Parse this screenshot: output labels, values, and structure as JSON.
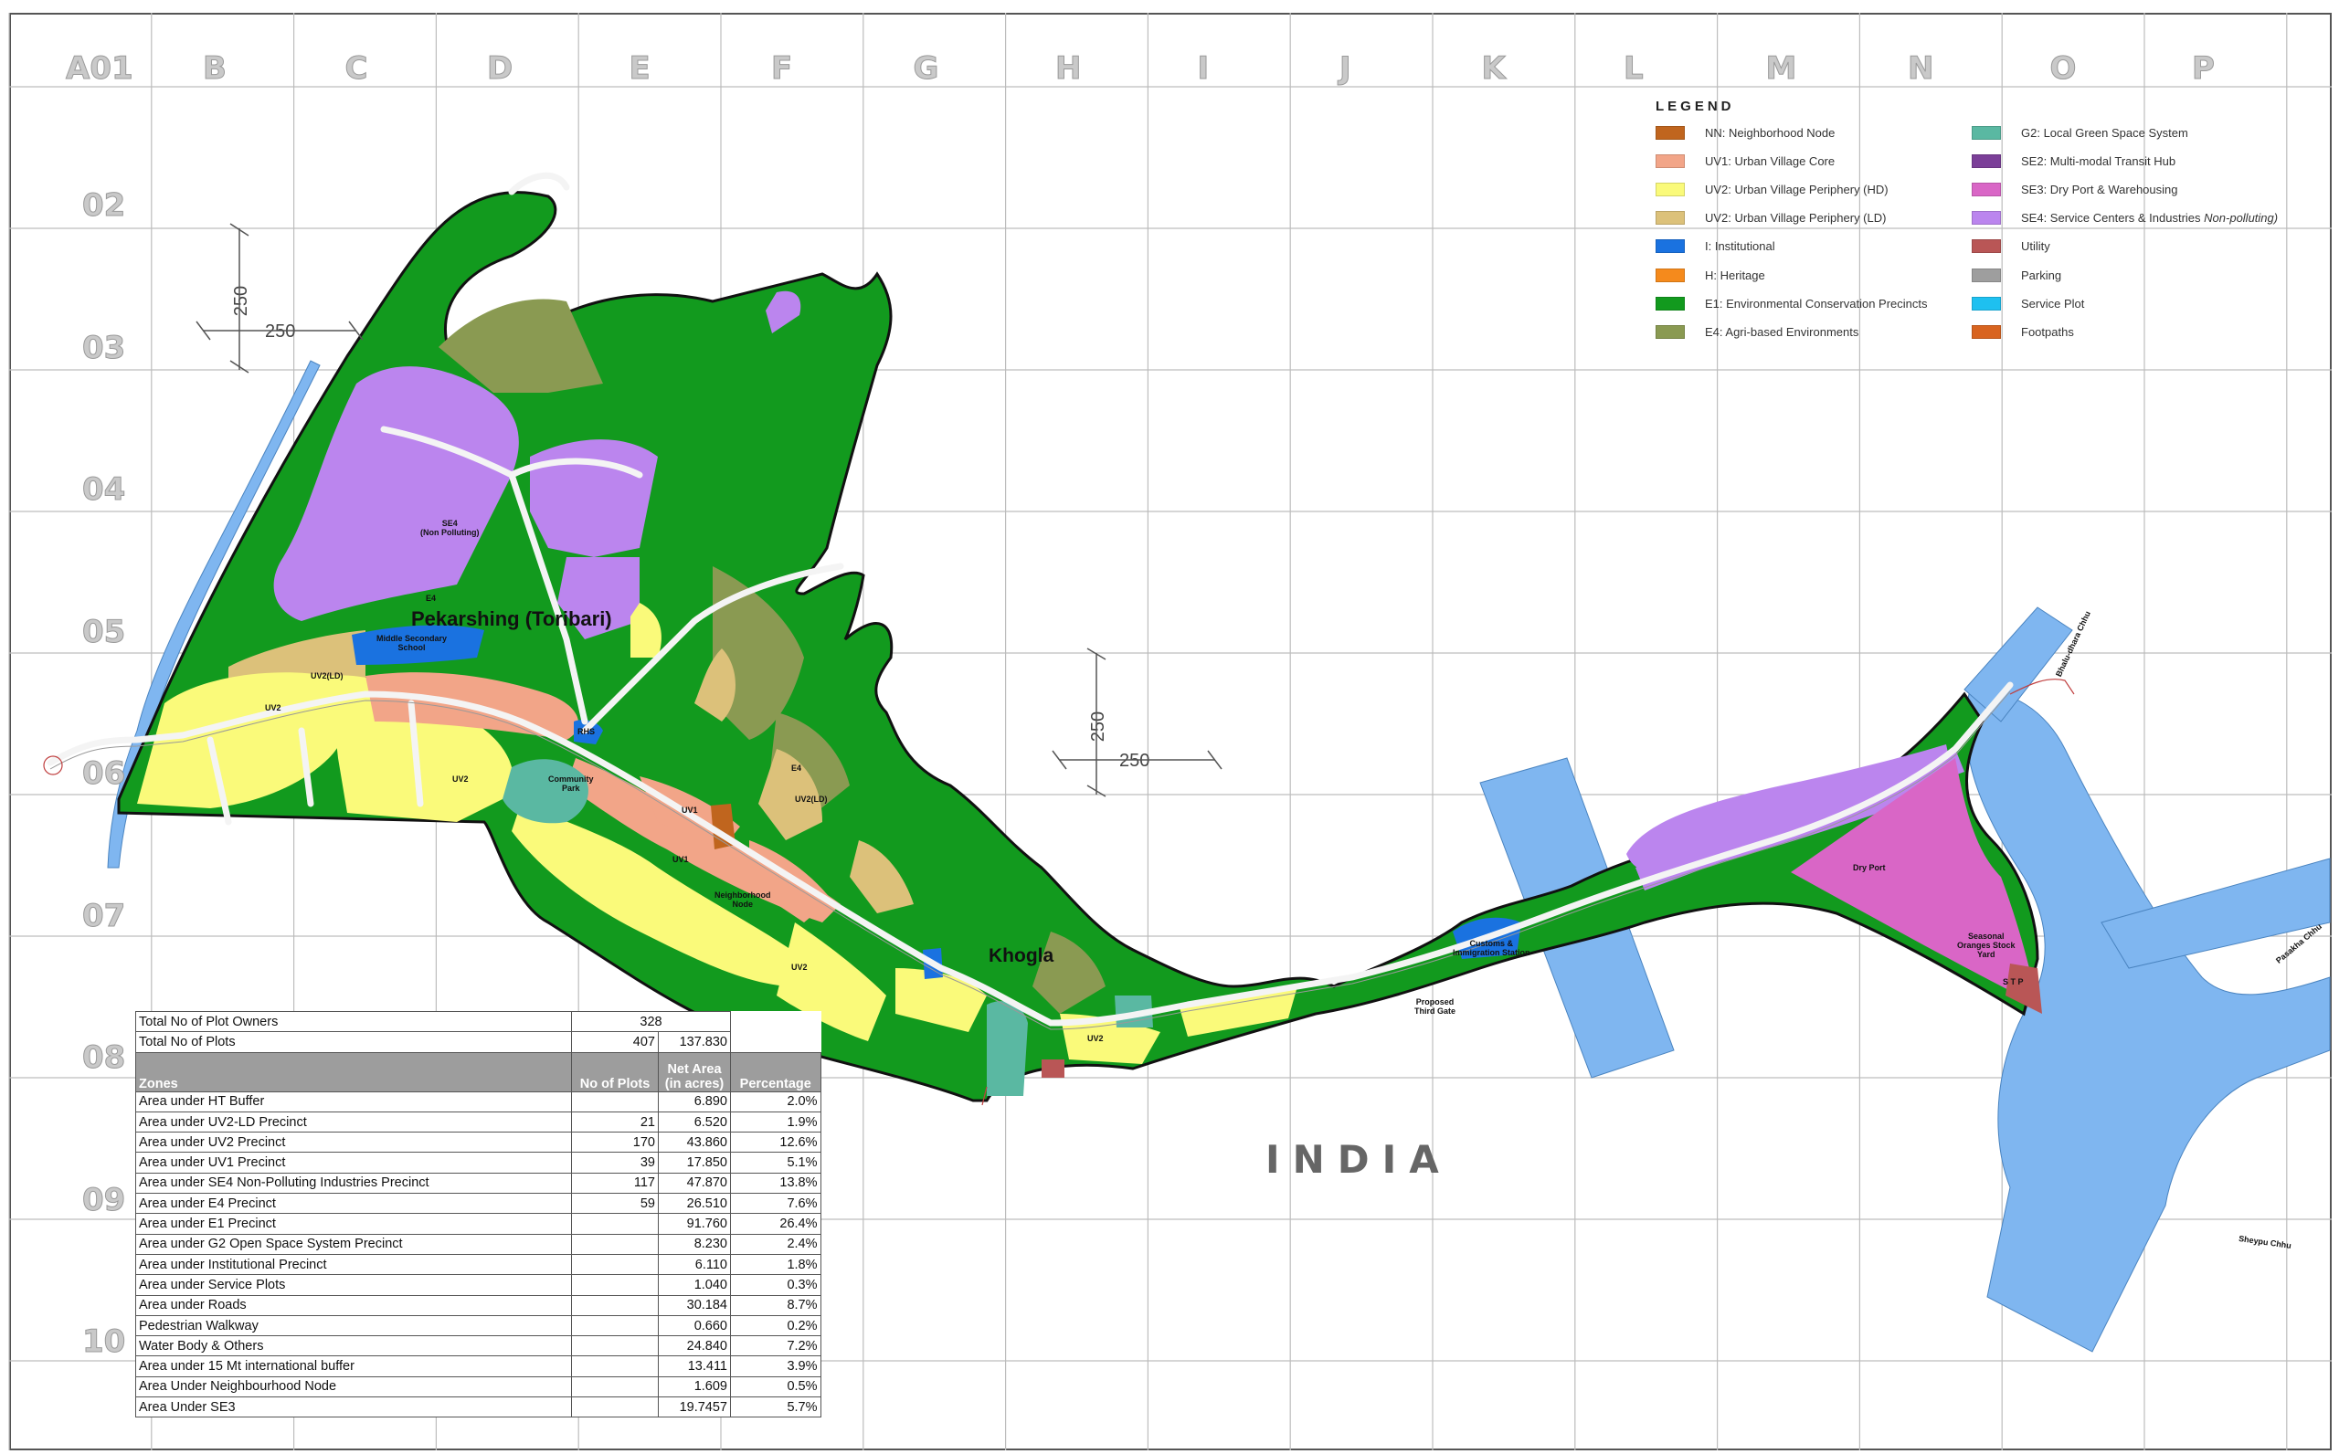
{
  "grid": {
    "columns": [
      "A01",
      "B",
      "C",
      "D",
      "E",
      "F",
      "G",
      "H",
      "I",
      "J",
      "K",
      "L",
      "M",
      "N",
      "O",
      "P"
    ],
    "rows": [
      "02",
      "03",
      "04",
      "05",
      "06",
      "07",
      "08",
      "09",
      "10"
    ]
  },
  "legend": {
    "title": "LEGEND",
    "items": [
      {
        "label": "NN: Neighborhood Node",
        "color": "#c0651e"
      },
      {
        "label": "UV1: Urban Village Core",
        "color": "#f2a588"
      },
      {
        "label": "UV2: Urban Village Periphery (HD)",
        "color": "#fafa7a"
      },
      {
        "label": "UV2: Urban Village Periphery (LD)",
        "color": "#dcc17a"
      },
      {
        "label": "I: Institutional",
        "color": "#1a72e0"
      },
      {
        "label": "H: Heritage",
        "color": "#f58a1c"
      },
      {
        "label": "E1: Environmental Conservation Precincts",
        "color": "#129a1e"
      },
      {
        "label": "E4: Agri-based Environments",
        "color": "#8a9a52"
      },
      {
        "label": "G2: Local Green Space System",
        "color": "#5ab8a2"
      },
      {
        "label": "SE2: Multi-modal Transit Hub",
        "color": "#7b3f98"
      },
      {
        "label": "SE3: Dry Port & Warehousing",
        "color": "#d966c6"
      },
      {
        "label": "SE4: Service Centers & Industries",
        "italic_suffix": "Non-polluting)",
        "color": "#bb85ee"
      },
      {
        "label": "Utility",
        "color": "#b95656"
      },
      {
        "label": "Parking",
        "color": "#9e9e9e"
      },
      {
        "label": "Service Plot",
        "color": "#1ec0f0"
      },
      {
        "label": "Footpaths",
        "color": "#d86420"
      }
    ]
  },
  "places": {
    "pekarshing": "Pekarshing (Toribari)",
    "khogla": "Khogla",
    "india": "INDIA",
    "se4_label": "SE4\n(Non Polluting)",
    "middle_school": "Middle Secondary\nSchool",
    "community_park": "Community\nPark",
    "neighborhood_node": "Neighborhood\nNode",
    "customs": "Customs &\nImmigration Station",
    "third_gate": "Proposed\nThird Gate",
    "dry_port": "Dry Port",
    "oranges_yard": "Seasonal\nOranges Stock\nYard",
    "stp": "S T P",
    "uv2_ld_a": "UV2(LD)",
    "uv2_ld_b": "UV2(LD)",
    "uv2_a": "UV2",
    "uv2_b": "UV2",
    "uv2_c": "UV2",
    "uv2_d": "UV2",
    "uv1_a": "UV1",
    "uv1_b": "UV1",
    "e4_a": "E4",
    "e4_b": "E4",
    "rhs": "RHS",
    "river_a": "Pasakha Chhu",
    "river_b": "Bhalu-dhara Chhu",
    "river_c": "Sheypu Chhu"
  },
  "dimensions": {
    "top_v": "250",
    "top_h": "250",
    "mid_v": "250",
    "mid_h": "250"
  },
  "stats_table": {
    "total_owners_label": "Total No of  Plot Owners",
    "total_owners": "328",
    "total_plots_label": "Total No of Plots",
    "total_plots": "407",
    "total_area": "137.830",
    "headers": {
      "zones": "Zones",
      "plots": "No of Plots",
      "area_line1": "Net Area",
      "area_line2": "(in acres)",
      "percentage": "Percentage"
    },
    "rows": [
      {
        "zone": "Area under HT Buffer",
        "plots": "",
        "area": "6.890",
        "pct": "2.0%"
      },
      {
        "zone": "Area under UV2-LD Precinct",
        "plots": "21",
        "area": "6.520",
        "pct": "1.9%"
      },
      {
        "zone": "Area under UV2 Precinct",
        "plots": "170",
        "area": "43.860",
        "pct": "12.6%"
      },
      {
        "zone": "Area under UV1 Precinct",
        "plots": "39",
        "area": "17.850",
        "pct": "5.1%"
      },
      {
        "zone": "Area under SE4 Non-Polluting Industries Precinct",
        "plots": "117",
        "area": "47.870",
        "pct": "13.8%"
      },
      {
        "zone": "Area under E4 Precinct",
        "plots": "59",
        "area": "26.510",
        "pct": "7.6%"
      },
      {
        "zone": "Area under E1 Precinct",
        "plots": "",
        "area": "91.760",
        "pct": "26.4%"
      },
      {
        "zone": "Area under G2 Open Space System Precinct",
        "plots": "",
        "area": "8.230",
        "pct": "2.4%"
      },
      {
        "zone": "Area under Institutional Precinct",
        "plots": "",
        "area": "6.110",
        "pct": "1.8%"
      },
      {
        "zone": "Area under Service Plots",
        "plots": "",
        "area": "1.040",
        "pct": "0.3%"
      },
      {
        "zone": "Area under Roads",
        "plots": "",
        "area": "30.184",
        "pct": "8.7%"
      },
      {
        "zone": "Pedestrian Walkway",
        "plots": "",
        "area": "0.660",
        "pct": "0.2%"
      },
      {
        "zone": "Water Body & Others",
        "plots": "",
        "area": "24.840",
        "pct": "7.2%"
      },
      {
        "zone": "Area under 15 Mt international buffer",
        "plots": "",
        "area": "13.411",
        "pct": "3.9%"
      },
      {
        "zone": "Area Under Neighbourhood Node",
        "plots": "",
        "area": "1.609",
        "pct": "0.5%"
      },
      {
        "zone": "Area Under SE3",
        "plots": "",
        "area": "19.7457",
        "pct": "5.7%"
      }
    ]
  },
  "colors": {
    "e1_green": "#129a1e",
    "uv2_yellow": "#fafa7a",
    "uv1_salmon": "#f2a588",
    "se4_purple": "#bb85ee",
    "se3_pink": "#d966c6",
    "water_blue": "#7fb6f0",
    "e4_olive": "#8a9a52",
    "uv2ld_tan": "#dcc17a",
    "institutional": "#1a72e0",
    "g2": "#5ab8a2"
  }
}
